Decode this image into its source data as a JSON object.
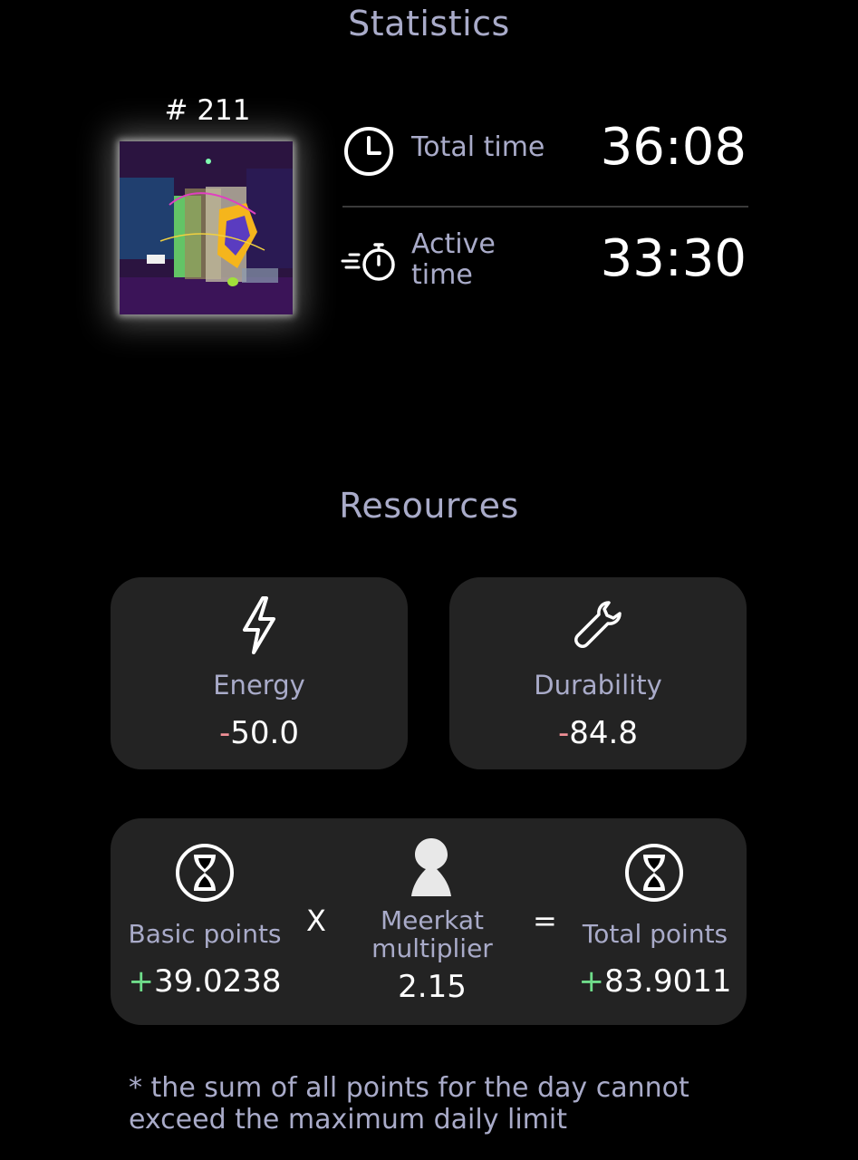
{
  "statistics": {
    "title": "Statistics",
    "nft_id": "# 211",
    "total_time_label": "Total time",
    "total_time_value": "36:08",
    "active_time_label": "Active time",
    "active_time_value": "33:30"
  },
  "resources": {
    "title": "Resources",
    "energy": {
      "label": "Energy",
      "sign": "-",
      "value": "50.0",
      "icon": "lightning-icon"
    },
    "durability": {
      "label": "Durability",
      "sign": "-",
      "value": "84.8",
      "icon": "wrench-icon"
    }
  },
  "points": {
    "basic": {
      "label": "Basic points",
      "sign": "+",
      "value": "39.0238",
      "icon": "hourglass-icon"
    },
    "operator_times": "X",
    "multiplier": {
      "label": "Meerkat multiplier",
      "value": "2.15",
      "icon": "meerkat-icon"
    },
    "operator_equals": "=",
    "total": {
      "label": "Total points",
      "sign": "+",
      "value": "83.9011",
      "icon": "hourglass-icon"
    }
  },
  "footnote": "* the sum of all points for the day cannot exceed the maximum daily limit",
  "colors": {
    "background": "#000000",
    "card": "#232323",
    "label": "#a9abc9",
    "negative": "#f08f96",
    "positive": "#6fdc8a"
  }
}
